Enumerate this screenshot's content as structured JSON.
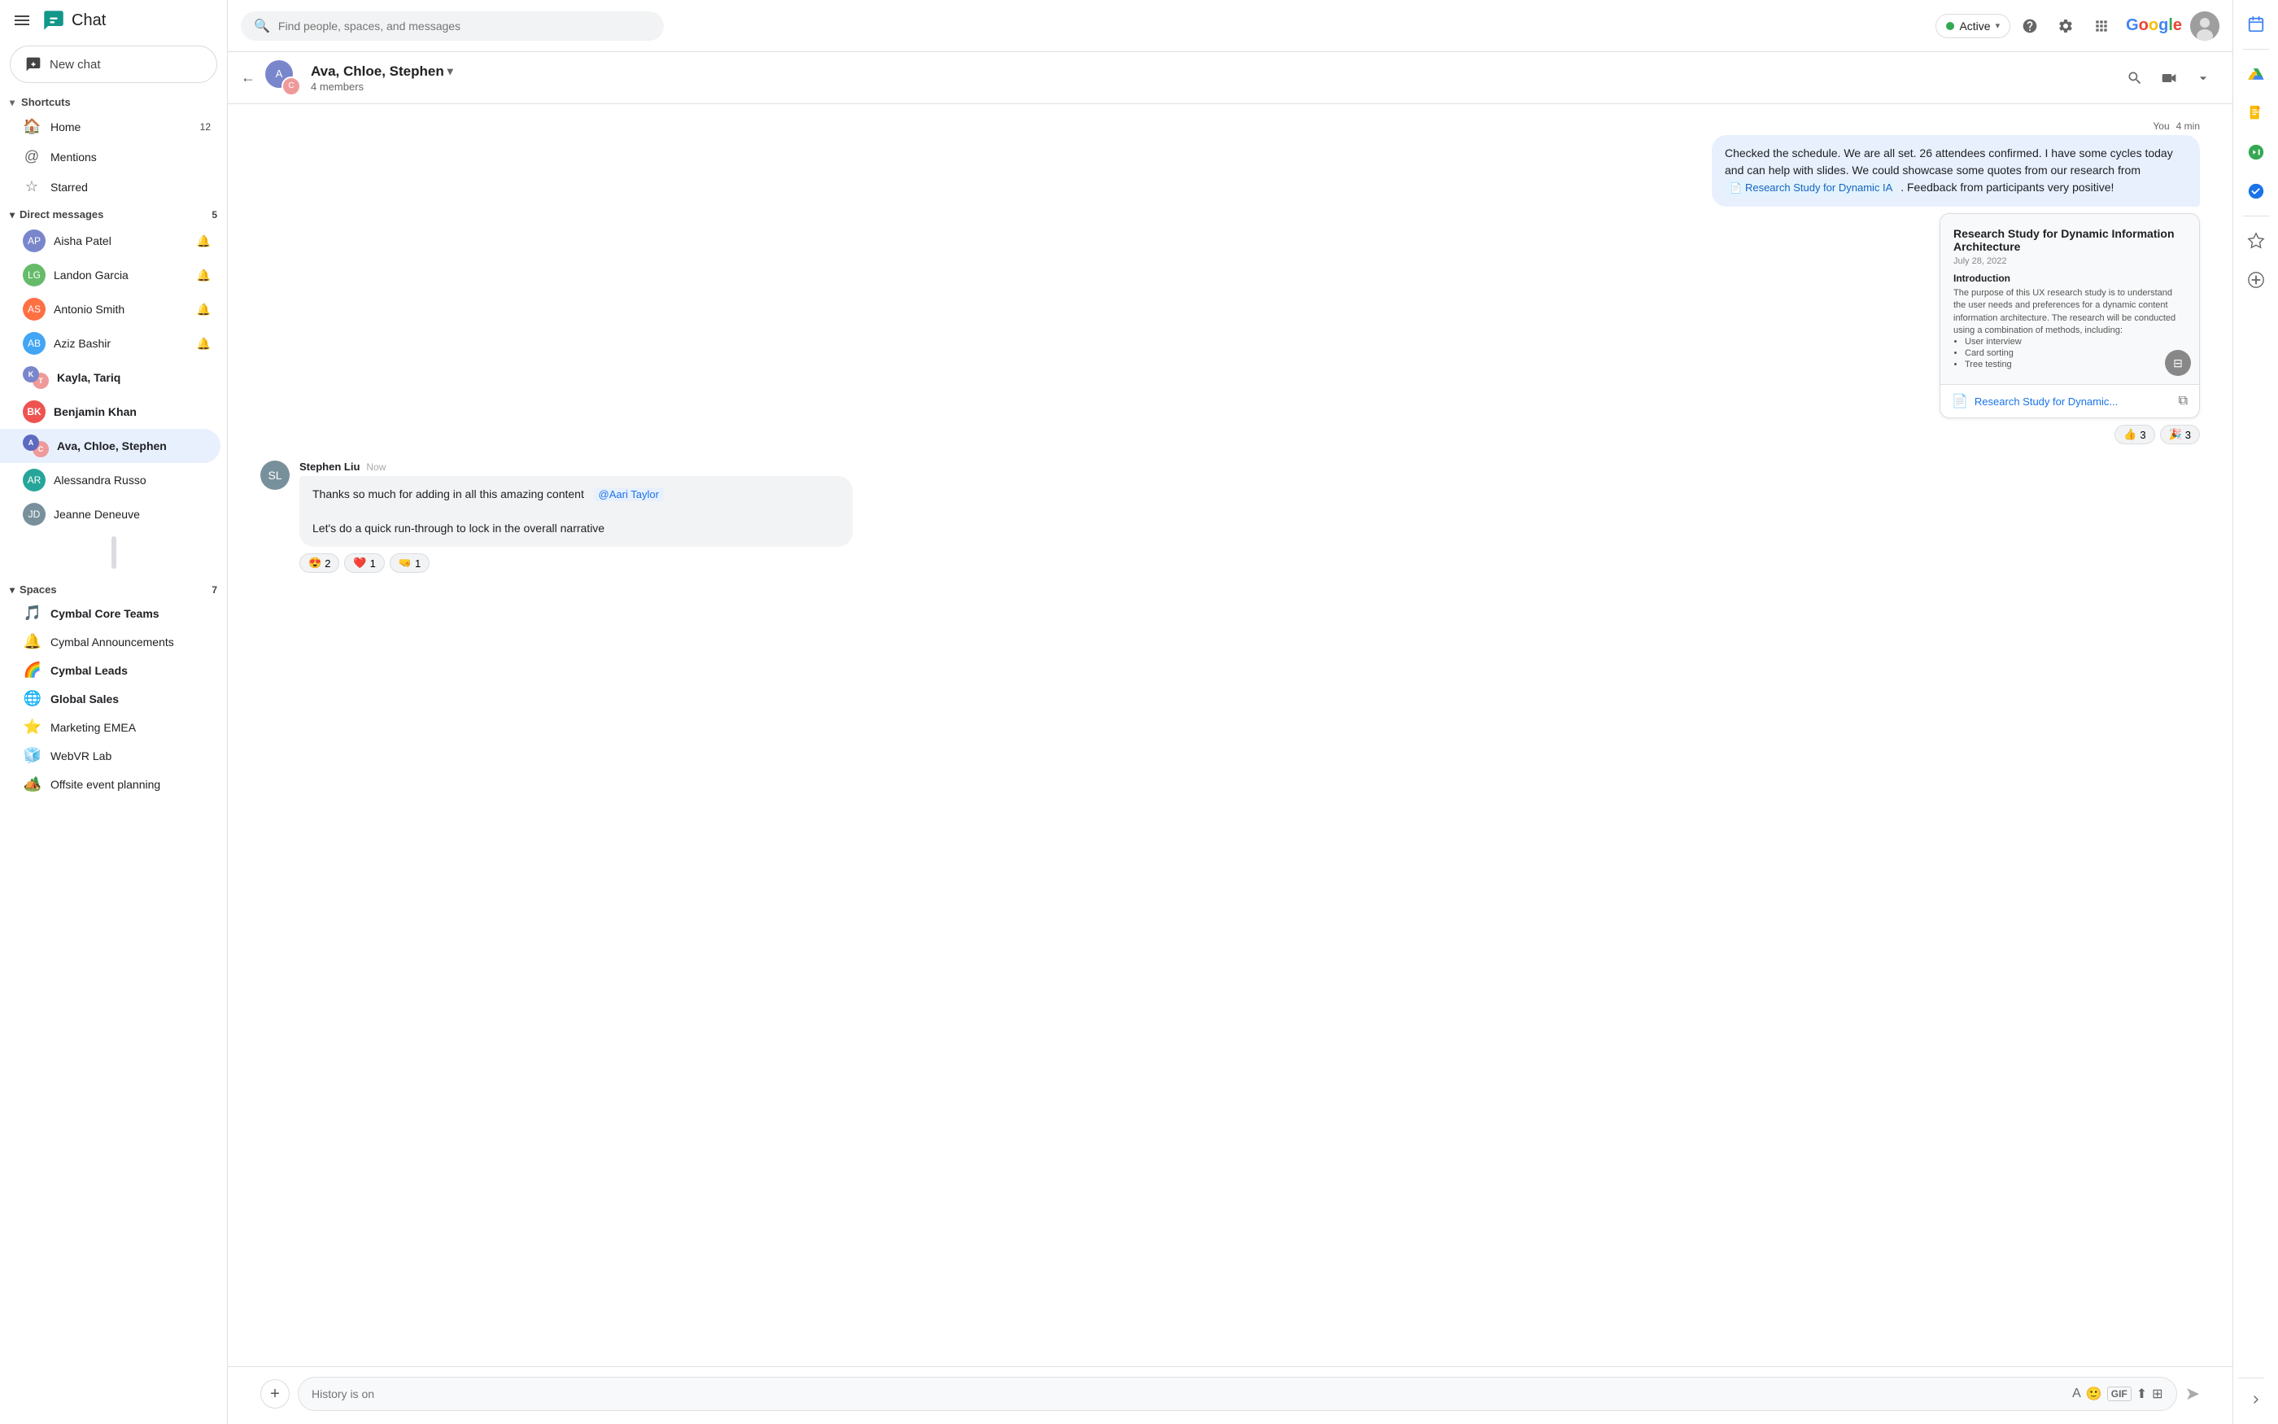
{
  "app": {
    "title": "Chat",
    "brand": "Google"
  },
  "topbar": {
    "search_placeholder": "Find people, spaces, and messages",
    "status_label": "Active",
    "new_chat_label": "New chat"
  },
  "sidebar": {
    "shortcuts_label": "Shortcuts",
    "nav_items": [
      {
        "id": "home",
        "label": "Home",
        "icon": "🏠",
        "badge": "12"
      },
      {
        "id": "mentions",
        "label": "Mentions",
        "icon": "@",
        "badge": ""
      },
      {
        "id": "starred",
        "label": "Starred",
        "icon": "☆",
        "badge": ""
      }
    ],
    "dm_section": {
      "label": "Direct messages",
      "badge": "5"
    },
    "dm_items": [
      {
        "id": "aisha-patel",
        "name": "Aisha Patel",
        "bold": false,
        "initials": "AP",
        "color": "#7986cb"
      },
      {
        "id": "landon-garcia",
        "name": "Landon Garcia",
        "bold": false,
        "initials": "LG",
        "color": "#66bb6a"
      },
      {
        "id": "antonio-smith",
        "name": "Antonio Smith",
        "bold": false,
        "initials": "AS",
        "color": "#ff7043"
      },
      {
        "id": "aziz-bashir",
        "name": "Aziz Bashir",
        "bold": false,
        "initials": "AB",
        "color": "#42a5f5"
      },
      {
        "id": "kayla-tariq",
        "name": "Kayla, Tariq",
        "bold": true,
        "initials": "KT",
        "color": "#ab47bc",
        "isGroup": true
      },
      {
        "id": "benjamin-khan",
        "name": "Benjamin Khan",
        "bold": true,
        "initials": "BK",
        "color": "#ef5350"
      },
      {
        "id": "ava-chloe-stephen",
        "name": "Ava, Chloe, Stephen",
        "bold": false,
        "active": true,
        "initials": "AC",
        "color": "#5c6bc0",
        "isGroup": true
      },
      {
        "id": "alessandra-russo",
        "name": "Alessandra Russo",
        "bold": false,
        "initials": "AR",
        "color": "#26a69a"
      },
      {
        "id": "jeanne-deneuve",
        "name": "Jeanne Deneuve",
        "bold": false,
        "initials": "JD",
        "color": "#78909c"
      }
    ],
    "spaces_section": {
      "label": "Spaces",
      "badge": "7"
    },
    "space_items": [
      {
        "id": "cymbal-core",
        "name": "Cymbal Core Teams",
        "emoji": "🎵",
        "bold": true
      },
      {
        "id": "cymbal-announce",
        "name": "Cymbal Announcements",
        "emoji": "🔔",
        "bold": false
      },
      {
        "id": "cymbal-leads",
        "name": "Cymbal Leads",
        "emoji": "🌈",
        "bold": true
      },
      {
        "id": "global-sales",
        "name": "Global Sales",
        "emoji": "🌐",
        "bold": true
      },
      {
        "id": "marketing-emea",
        "name": "Marketing EMEA",
        "emoji": "⭐",
        "bold": false
      },
      {
        "id": "webvr-lab",
        "name": "WebVR Lab",
        "emoji": "🧊",
        "bold": false
      },
      {
        "id": "offsite-event",
        "name": "Offsite event planning",
        "emoji": "🏕️",
        "bold": false
      }
    ]
  },
  "chat_header": {
    "title": "Ava, Chloe, Stephen",
    "chevron": "▾",
    "members": "4 members",
    "back": "←"
  },
  "messages": [
    {
      "id": "msg1",
      "sender": "You",
      "time": "4 min",
      "side": "right",
      "text": "Checked the schedule. We are all set. 26 attendees confirmed. I have some cycles today and can help with slides. We could showcase some quotes from our research from",
      "has_doc_chip": true,
      "doc_chip_label": "Research Study for Dynamic IA",
      "text_after": ". Feedback from participants very positive!",
      "has_reactions": false
    }
  ],
  "doc_card": {
    "title": "Research Study for Dynamic Information Architecture",
    "date": "July 28, 2022",
    "section": "Introduction",
    "body": "The purpose of this UX research study is to understand the user needs and preferences for a dynamic content information architecture. The research will be conducted using a combination of methods, including:",
    "list_items": [
      "User interview",
      "Card sorting",
      "Tree testing"
    ],
    "footer_name": "Research Study for Dynamic...",
    "reactions": [
      {
        "emoji": "👍",
        "count": "3"
      },
      {
        "emoji": "🎉",
        "count": "3"
      }
    ]
  },
  "left_message": {
    "sender": "Stephen Liu",
    "time": "Now",
    "initials": "SL",
    "avatar_color": "#78909c",
    "line1_pre": "Thanks so much for adding in all this amazing content",
    "mention": "@Aari Taylor",
    "line2": "Let's do a quick run-through to lock in the overall narrative",
    "reactions": [
      {
        "emoji": "😍",
        "count": "2"
      },
      {
        "emoji": "❤️",
        "count": "1"
      },
      {
        "emoji": "🤜",
        "count": "1"
      }
    ]
  },
  "input": {
    "placeholder": "History is on"
  },
  "right_rail": {
    "items": [
      {
        "id": "drive",
        "icon": "▲",
        "color": "#4285f4",
        "label": "Drive"
      },
      {
        "id": "docs",
        "icon": "📄",
        "color": "#fbbc05",
        "label": "Docs"
      },
      {
        "id": "meet",
        "icon": "📞",
        "color": "#34a853",
        "label": "Meet"
      },
      {
        "id": "tasks",
        "icon": "✓",
        "color": "#1a73e8",
        "label": "Tasks"
      },
      {
        "id": "starred-rail",
        "icon": "☆",
        "color": "#666",
        "label": "Starred"
      },
      {
        "id": "add-rail",
        "icon": "+",
        "color": "#666",
        "label": "Add"
      }
    ],
    "calendar_icon": "📅",
    "expand_icon": "❯"
  }
}
